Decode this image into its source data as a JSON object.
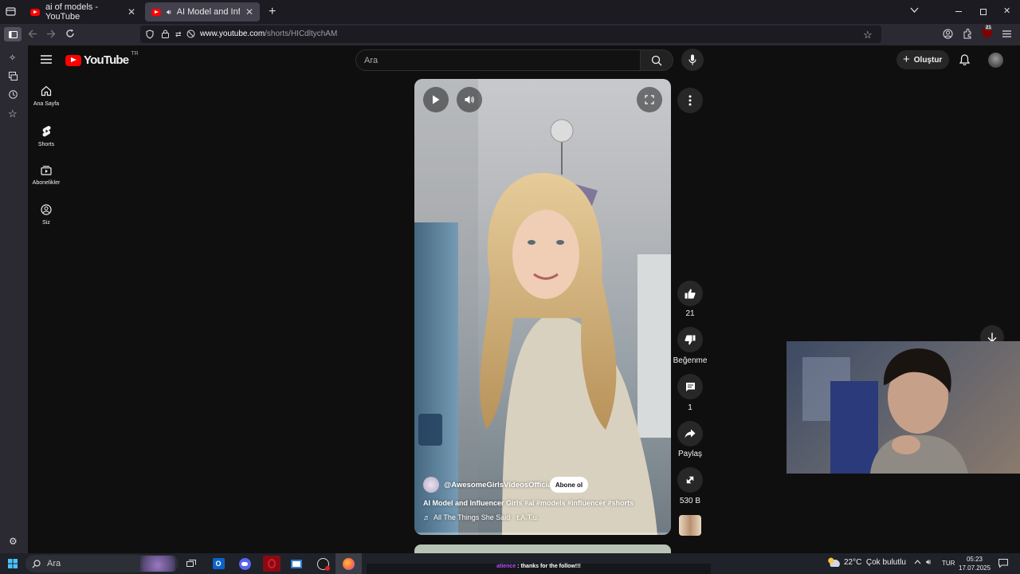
{
  "browser": {
    "tabs": [
      {
        "label": "ai of models - YouTube",
        "active": false
      },
      {
        "label": "AI Model and Influencer Gi",
        "active": true
      }
    ],
    "url_host": "www.youtube.com",
    "url_path": "/shorts/HICdltychAM",
    "extension_badge": "21"
  },
  "youtube": {
    "logo_text": "YouTube",
    "region": "TR",
    "search_placeholder": "Ara",
    "create_label": "Oluştur",
    "nav": [
      {
        "label": "Ana Sayfa",
        "icon": "home-icon"
      },
      {
        "label": "Shorts",
        "icon": "shorts-icon"
      },
      {
        "label": "Abonelikler",
        "icon": "subscriptions-icon"
      },
      {
        "label": "Siz",
        "icon": "you-icon"
      }
    ]
  },
  "short": {
    "channel": "@AwesomeGirlsVideosOfficial",
    "subscribe_label": "Abone ol",
    "title": "AI Model and Influencer Girls #ai #models #influencer #shorts",
    "music": "All The Things She Said · t.A.T.u.",
    "actions": {
      "like_count": "21",
      "dislike_label": "Beğenme",
      "comment_count": "1",
      "share_label": "Paylaş",
      "remix_count": "530 B"
    }
  },
  "taskbar": {
    "search_placeholder": "Ara",
    "stream_chat": "atience : thanks for the follow!!!",
    "stream_chat_user": "atience",
    "stream_chat_message": " : thanks for the follow!!!",
    "weather": "22°C  Çok bulutlu",
    "language": "TUR",
    "time": "05:23",
    "date": "17.07.2025"
  },
  "colors": {
    "youtube_red": "#ff0000",
    "page_bg": "#0f0f0f",
    "browser_chrome": "#2b2a33"
  }
}
